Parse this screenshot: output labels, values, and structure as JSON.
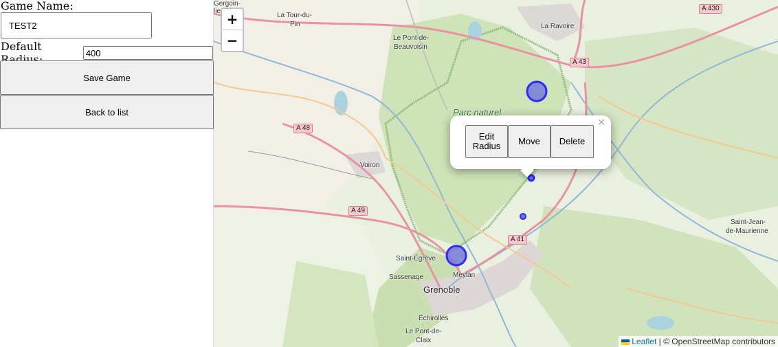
{
  "form": {
    "game_name_label": "Game Name:",
    "game_name_value": "TEST2",
    "radius_label": "Default Radius:",
    "radius_value": "400",
    "save_label": "Save Game",
    "back_label": "Back to list"
  },
  "map": {
    "zoom_in": "+",
    "zoom_out": "−",
    "places": {
      "gergoin": "Gergoin-",
      "lieu": "lieu",
      "tour_du_pin_1": "La Tour-du-",
      "tour_du_pin_2": "Pin",
      "pont_beauvoisin_1": "Le Pont-de-",
      "pont_beauvoisin_2": "Beauvoisin",
      "la_ravoire": "La Ravoire",
      "voiron": "Voiron",
      "saint_egreve": "Saint-Égrève",
      "sassenage": "Sassenage",
      "meylan": "Meylan",
      "grenoble": "Grenoble",
      "echirolles": "Échirolles",
      "pont_claix_1": "Le Pont-de-",
      "pont_claix_2": "Claix",
      "saint_jean_1": "Saint-Jean-",
      "saint_jean_2": "de-Maurienne",
      "parc": "Parc naturel"
    },
    "shields": {
      "a430": "A 430",
      "a43": "A 43",
      "a48": "A 48",
      "a49": "A 49",
      "a41": "A 41"
    },
    "popup": {
      "close": "×",
      "edit_radius_1": "Edit",
      "edit_radius_2": "Radius",
      "move": "Move",
      "delete": "Delete"
    },
    "attribution": {
      "leaflet": "Leaflet",
      "separator": " | © ",
      "osm": "OpenStreetMap contributors"
    },
    "colors": {
      "marker": "#2b2bff",
      "marker_fill": "#6f74d8"
    }
  }
}
